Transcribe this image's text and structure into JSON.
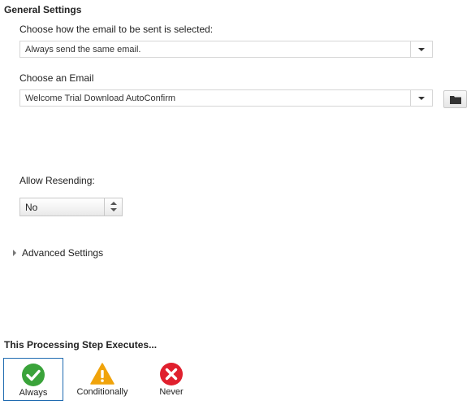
{
  "general": {
    "title": "General Settings",
    "selection_label": "Choose how the email to be sent is selected:",
    "selection_value": "Always send the same email.",
    "email_label": "Choose an Email",
    "email_value": "Welcome Trial Download AutoConfirm",
    "resend_label": "Allow Resending:",
    "resend_value": "No"
  },
  "advanced": {
    "label": "Advanced Settings"
  },
  "execution": {
    "title": "This Processing Step Executes...",
    "selected": "Always",
    "options": [
      {
        "label": "Always",
        "icon": "check-circle-icon",
        "color": "#3aa33a"
      },
      {
        "label": "Conditionally",
        "icon": "warning-triangle-icon",
        "color": "#f0a30a"
      },
      {
        "label": "Never",
        "icon": "x-circle-icon",
        "color": "#e0202e"
      }
    ]
  },
  "colors": {
    "selected_border": "#1f6bb0"
  }
}
